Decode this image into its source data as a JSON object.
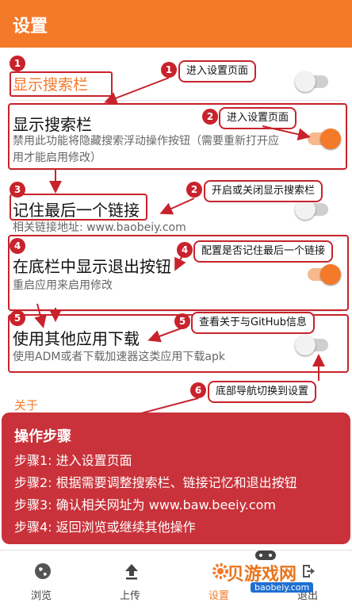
{
  "app": {
    "title": "设置"
  },
  "settings": [
    {
      "title": "显示搜索栏",
      "desc": "禁用此功能将隐藏搜索浮动操作按钮（需要重新打开应用才能启用修改）"
    },
    {
      "title": "记住最后一个链接",
      "desc": "相关链接地址: www.baobeiy.com"
    },
    {
      "title": "在底栏中显示退出按钮",
      "desc": "重启应用来启用修改"
    },
    {
      "title": "使用其他应用下载",
      "desc": "使用ADM或者下载加速器这类应用下载apk"
    }
  ],
  "toggles": [
    {
      "name": "search-bar-toggle-top",
      "on": false
    },
    {
      "name": "search-bar-toggle",
      "on": true
    },
    {
      "name": "remember-link-toggle",
      "on": false
    },
    {
      "name": "exit-button-toggle",
      "on": true
    },
    {
      "name": "other-app-download-toggle",
      "on": false
    }
  ],
  "annotations": {
    "top_label": "显示搜索栏",
    "callouts": [
      "进入设置页面",
      "进入设置页面",
      "开启或关闭显示搜索栏",
      "配置是否记住最后一个链接",
      "查看关于与GitHub信息",
      "底部导航切换到设置"
    ],
    "numbers": [
      "1",
      "2",
      "3",
      "4",
      "5",
      "6",
      "1",
      "2"
    ]
  },
  "about": {
    "label": "关于"
  },
  "steps_panel": {
    "title": "操作步骤",
    "steps": [
      "步骤1: 进入设置页面",
      "步骤2: 根据需要调整搜索栏、链接记忆和退出按钮",
      "步骤3: 确认相关网址为 www.baw.beeiy.com",
      "步骤4: 返回浏览或继续其他操作"
    ]
  },
  "nav": [
    {
      "label": "浏览",
      "icon": "globe-icon"
    },
    {
      "label": "上传",
      "icon": "upload-icon"
    },
    {
      "label": "设置",
      "icon": "gear-icon"
    },
    {
      "label": "退出",
      "icon": "exit-icon"
    }
  ],
  "watermark": {
    "text": "贝游戏网",
    "url": "baobeiy.com"
  },
  "colors": {
    "accent": "#f47a2a",
    "annotation": "#c8232c",
    "panel": "#c9323a"
  }
}
